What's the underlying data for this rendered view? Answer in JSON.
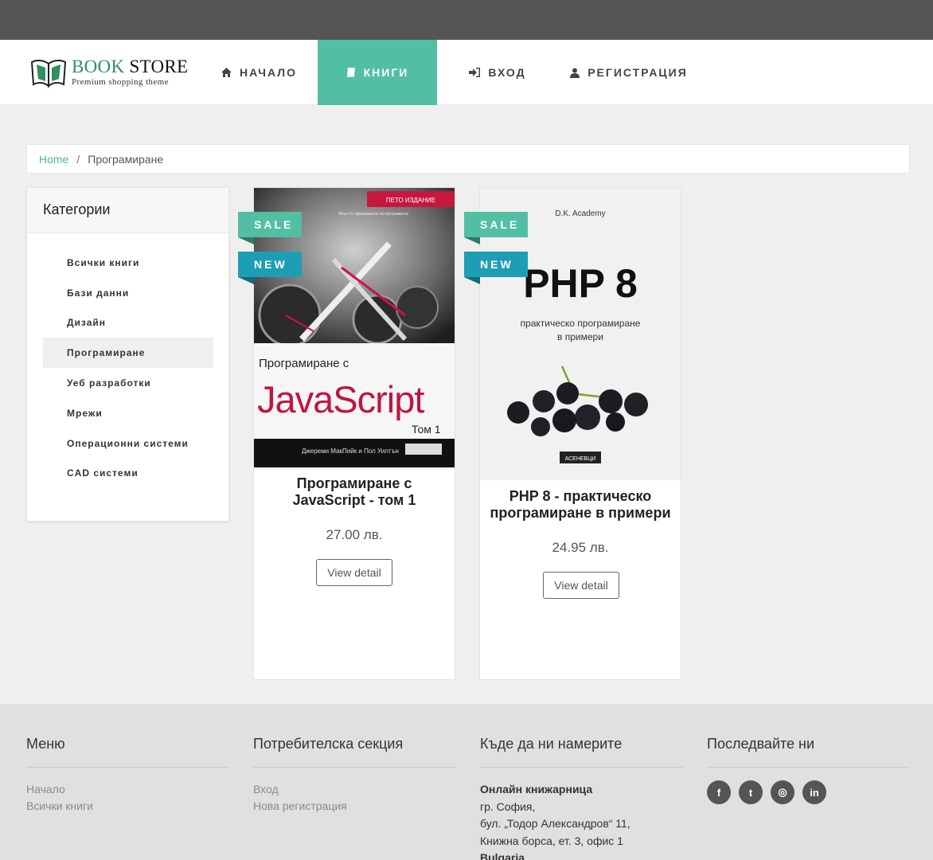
{
  "brand": {
    "title_part1": "BOOK",
    "title_part2": "STORE",
    "subtitle": "Premium shopping theme"
  },
  "nav": {
    "items": [
      {
        "label": "НАЧАЛО",
        "icon": "home-icon",
        "active": false
      },
      {
        "label": "КНИГИ",
        "icon": "book-icon",
        "active": true
      },
      {
        "label": "ВХОД",
        "icon": "sign-in-icon",
        "active": false
      },
      {
        "label": "РЕГИСТРАЦИЯ",
        "icon": "user-plus-icon",
        "active": false
      }
    ]
  },
  "breadcrumb": {
    "home": "Home",
    "separator": "/",
    "current": "Програмиране"
  },
  "sidebar": {
    "title": "Категории",
    "items": [
      {
        "label": "Всички книги",
        "active": false
      },
      {
        "label": "Бази данни",
        "active": false
      },
      {
        "label": "Дизайн",
        "active": false
      },
      {
        "label": "Програмиране",
        "active": true
      },
      {
        "label": "Уеб разработки",
        "active": false
      },
      {
        "label": "Мрежи",
        "active": false
      },
      {
        "label": "Операционни системи",
        "active": false
      },
      {
        "label": "CAD системи",
        "active": false
      }
    ]
  },
  "products": [
    {
      "title": "Програмиране с JavaScript - том 1",
      "price": "27.00 лв.",
      "button": "View detail",
      "badges": [
        "SALE",
        "NEW"
      ],
      "cover": {
        "edition": "ПЕТО ИЗДАНИЕ",
        "tagline": "Wrox От програмисти за програмисти",
        "line1": "Програмиране с",
        "line2": "JavaScript",
        "line3": "Том 1",
        "authors": "Джереми МакПийк и Пол Уилтън"
      }
    },
    {
      "title": "PHP 8 - практическо програмиране в примери",
      "price": "24.95 лв.",
      "button": "View detail",
      "badges": [
        "SALE",
        "NEW"
      ],
      "cover": {
        "publisher_top": "D.K. Academy",
        "big": "PHP 8",
        "sub1": "практическо програмиране",
        "sub2": "в примери",
        "publisher_bottom": "АСЕНЕВЦИ"
      }
    }
  ],
  "footer": {
    "menu": {
      "title": "Меню",
      "links": [
        "Начало",
        "Всички книги"
      ]
    },
    "user": {
      "title": "Потребителска секция",
      "links": [
        "Вход",
        "Нова регистрация"
      ]
    },
    "location": {
      "title": "Къде да ни намерите",
      "name": "Онлайн книжарница",
      "line1": "гр. София,",
      "line2": "бул. „Тодор Александров“ 11,",
      "line3": "Книжна борса, ет. 3, офис 1",
      "country": "Bulgaria"
    },
    "follow": {
      "title": "Последвайте ни",
      "icons": [
        "facebook-icon",
        "twitter-icon",
        "instagram-icon",
        "linkedin-icon"
      ],
      "glyphs": [
        "f",
        "t",
        "◎",
        "in"
      ]
    }
  },
  "colors": {
    "accent": "#52bfa5",
    "new_badge": "#1e9eb5",
    "topbar": "#555555"
  }
}
